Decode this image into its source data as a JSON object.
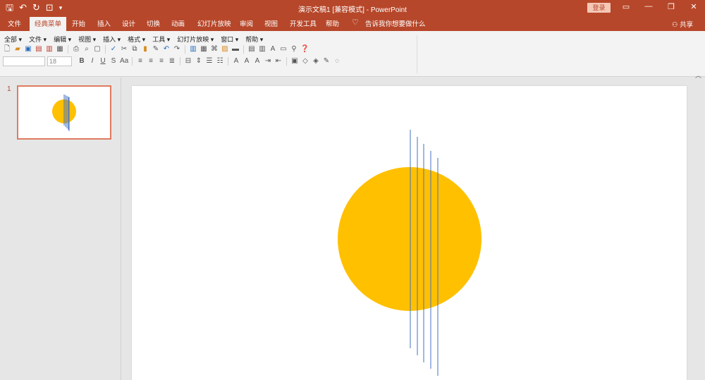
{
  "titlebar": {
    "title": "演示文稿1 [兼容模式]  -  PowerPoint",
    "login_label": "登录",
    "bg_color": "#b7472a"
  },
  "tabs": [
    {
      "label": "文件"
    },
    {
      "label": "经典菜单"
    },
    {
      "label": "开始"
    },
    {
      "label": "插入"
    },
    {
      "label": "设计"
    },
    {
      "label": "切换"
    },
    {
      "label": "动画"
    },
    {
      "label": "幻灯片放映"
    },
    {
      "label": "审阅"
    },
    {
      "label": "视图"
    },
    {
      "label": "开发工具"
    },
    {
      "label": "帮助"
    }
  ],
  "tell_me": "告诉我你想要做什么",
  "share_label": "共享",
  "menu": [
    "全部 ▾",
    "文件 ▾",
    "编辑 ▾",
    "视图 ▾",
    "插入 ▾",
    "格式 ▾",
    "工具 ▾",
    "幻灯片放映 ▾",
    "窗口 ▾",
    "帮助 ▾"
  ],
  "font_size_value": "18",
  "slide_panel": {
    "slide_number": "1"
  },
  "slide": {
    "circle_color": "#ffc000",
    "line_color": "#4472c4"
  }
}
